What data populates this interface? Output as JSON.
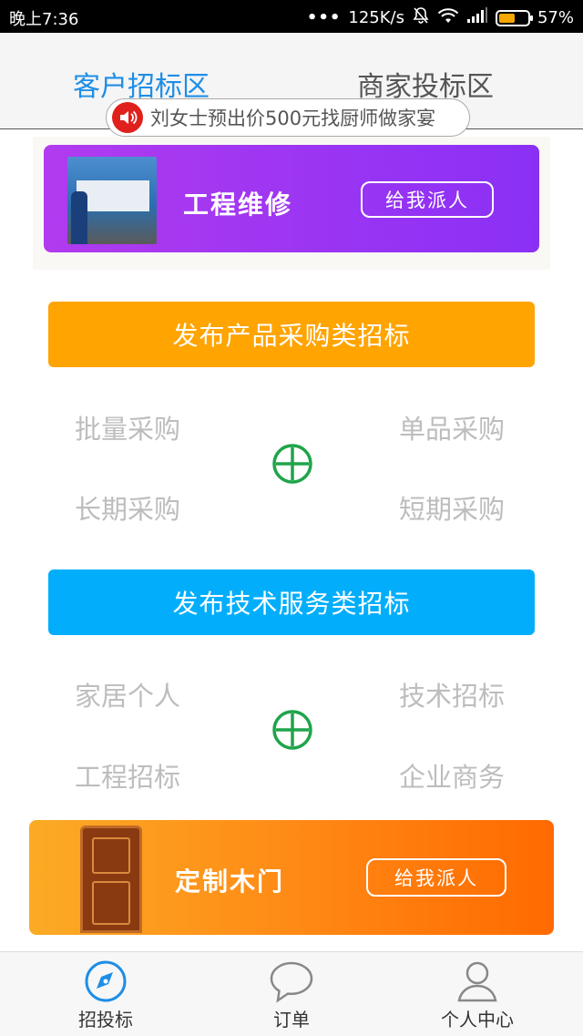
{
  "status_bar": {
    "time": "晚上7:36",
    "dots": "•••",
    "speed": "125K/s",
    "battery": "57%",
    "battery_level": 0.57
  },
  "tabs": [
    {
      "label": "客户招标区",
      "active": true
    },
    {
      "label": "商家投标区",
      "active": false
    }
  ],
  "notice": {
    "text": "刘女士预出价500元找厨师做家宴",
    "icon": "speaker-icon"
  },
  "banner_top": {
    "title": "工程维修",
    "button": "给我派人",
    "color_start": "#b13bef",
    "color_end": "#8a30f5"
  },
  "product_section": {
    "button": "发布产品采购类招标",
    "color": "#ffa400",
    "options": [
      "批量采购",
      "单品采购",
      "长期采购",
      "短期采购"
    ]
  },
  "service_section": {
    "button": "发布技术服务类招标",
    "color": "#02aefc",
    "options": [
      "家居个人",
      "技术招标",
      "工程招标",
      "企业商务"
    ]
  },
  "banner_bottom": {
    "title": "定制木门",
    "button": "给我派人"
  },
  "bottom_nav": [
    {
      "label": "招投标",
      "icon": "compass-icon",
      "active": true
    },
    {
      "label": "订单",
      "icon": "chat-bubble-icon",
      "active": false
    },
    {
      "label": "个人中心",
      "icon": "person-icon",
      "active": false
    }
  ],
  "colors": {
    "accent": "#1e8ee6",
    "plus": "#1fa44a"
  }
}
